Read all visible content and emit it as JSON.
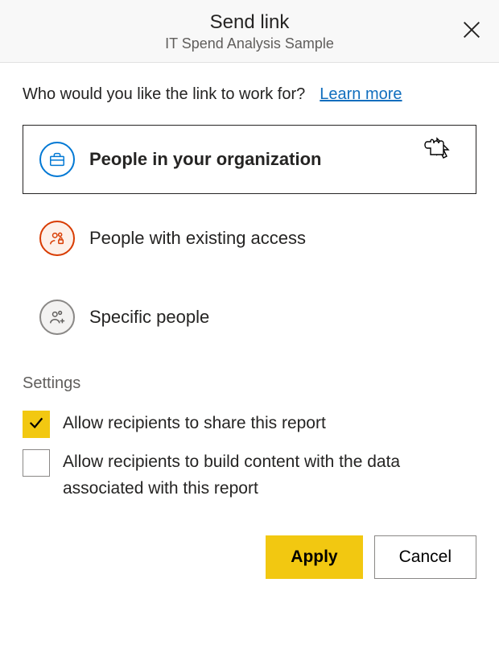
{
  "header": {
    "title": "Send link",
    "subtitle": "IT Spend Analysis Sample"
  },
  "prompt": "Who would you like the link to work for?",
  "learn_more": "Learn more",
  "options": {
    "org": "People in your organization",
    "existing": "People with existing access",
    "specific": "Specific people"
  },
  "settings": {
    "title": "Settings",
    "allow_share": "Allow recipients to share this report",
    "allow_build": "Allow recipients to build content with the data associated with this report"
  },
  "buttons": {
    "apply": "Apply",
    "cancel": "Cancel"
  }
}
